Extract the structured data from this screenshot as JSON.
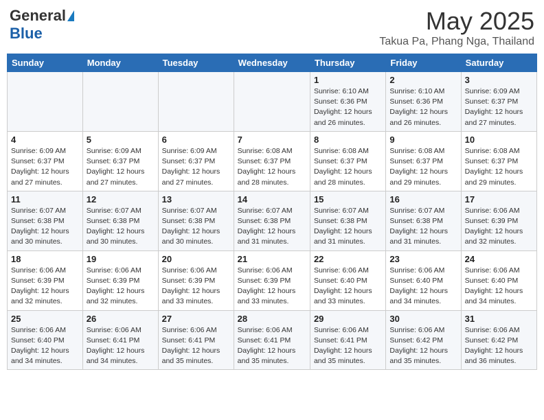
{
  "header": {
    "logo_general": "General",
    "logo_blue": "Blue",
    "month": "May 2025",
    "location": "Takua Pa, Phang Nga, Thailand"
  },
  "weekdays": [
    "Sunday",
    "Monday",
    "Tuesday",
    "Wednesday",
    "Thursday",
    "Friday",
    "Saturday"
  ],
  "weeks": [
    [
      {
        "day": "",
        "info": ""
      },
      {
        "day": "",
        "info": ""
      },
      {
        "day": "",
        "info": ""
      },
      {
        "day": "",
        "info": ""
      },
      {
        "day": "1",
        "info": "Sunrise: 6:10 AM\nSunset: 6:36 PM\nDaylight: 12 hours\nand 26 minutes."
      },
      {
        "day": "2",
        "info": "Sunrise: 6:10 AM\nSunset: 6:36 PM\nDaylight: 12 hours\nand 26 minutes."
      },
      {
        "day": "3",
        "info": "Sunrise: 6:09 AM\nSunset: 6:37 PM\nDaylight: 12 hours\nand 27 minutes."
      }
    ],
    [
      {
        "day": "4",
        "info": "Sunrise: 6:09 AM\nSunset: 6:37 PM\nDaylight: 12 hours\nand 27 minutes."
      },
      {
        "day": "5",
        "info": "Sunrise: 6:09 AM\nSunset: 6:37 PM\nDaylight: 12 hours\nand 27 minutes."
      },
      {
        "day": "6",
        "info": "Sunrise: 6:09 AM\nSunset: 6:37 PM\nDaylight: 12 hours\nand 27 minutes."
      },
      {
        "day": "7",
        "info": "Sunrise: 6:08 AM\nSunset: 6:37 PM\nDaylight: 12 hours\nand 28 minutes."
      },
      {
        "day": "8",
        "info": "Sunrise: 6:08 AM\nSunset: 6:37 PM\nDaylight: 12 hours\nand 28 minutes."
      },
      {
        "day": "9",
        "info": "Sunrise: 6:08 AM\nSunset: 6:37 PM\nDaylight: 12 hours\nand 29 minutes."
      },
      {
        "day": "10",
        "info": "Sunrise: 6:08 AM\nSunset: 6:37 PM\nDaylight: 12 hours\nand 29 minutes."
      }
    ],
    [
      {
        "day": "11",
        "info": "Sunrise: 6:07 AM\nSunset: 6:38 PM\nDaylight: 12 hours\nand 30 minutes."
      },
      {
        "day": "12",
        "info": "Sunrise: 6:07 AM\nSunset: 6:38 PM\nDaylight: 12 hours\nand 30 minutes."
      },
      {
        "day": "13",
        "info": "Sunrise: 6:07 AM\nSunset: 6:38 PM\nDaylight: 12 hours\nand 30 minutes."
      },
      {
        "day": "14",
        "info": "Sunrise: 6:07 AM\nSunset: 6:38 PM\nDaylight: 12 hours\nand 31 minutes."
      },
      {
        "day": "15",
        "info": "Sunrise: 6:07 AM\nSunset: 6:38 PM\nDaylight: 12 hours\nand 31 minutes."
      },
      {
        "day": "16",
        "info": "Sunrise: 6:07 AM\nSunset: 6:38 PM\nDaylight: 12 hours\nand 31 minutes."
      },
      {
        "day": "17",
        "info": "Sunrise: 6:06 AM\nSunset: 6:39 PM\nDaylight: 12 hours\nand 32 minutes."
      }
    ],
    [
      {
        "day": "18",
        "info": "Sunrise: 6:06 AM\nSunset: 6:39 PM\nDaylight: 12 hours\nand 32 minutes."
      },
      {
        "day": "19",
        "info": "Sunrise: 6:06 AM\nSunset: 6:39 PM\nDaylight: 12 hours\nand 32 minutes."
      },
      {
        "day": "20",
        "info": "Sunrise: 6:06 AM\nSunset: 6:39 PM\nDaylight: 12 hours\nand 33 minutes."
      },
      {
        "day": "21",
        "info": "Sunrise: 6:06 AM\nSunset: 6:39 PM\nDaylight: 12 hours\nand 33 minutes."
      },
      {
        "day": "22",
        "info": "Sunrise: 6:06 AM\nSunset: 6:40 PM\nDaylight: 12 hours\nand 33 minutes."
      },
      {
        "day": "23",
        "info": "Sunrise: 6:06 AM\nSunset: 6:40 PM\nDaylight: 12 hours\nand 34 minutes."
      },
      {
        "day": "24",
        "info": "Sunrise: 6:06 AM\nSunset: 6:40 PM\nDaylight: 12 hours\nand 34 minutes."
      }
    ],
    [
      {
        "day": "25",
        "info": "Sunrise: 6:06 AM\nSunset: 6:40 PM\nDaylight: 12 hours\nand 34 minutes."
      },
      {
        "day": "26",
        "info": "Sunrise: 6:06 AM\nSunset: 6:41 PM\nDaylight: 12 hours\nand 34 minutes."
      },
      {
        "day": "27",
        "info": "Sunrise: 6:06 AM\nSunset: 6:41 PM\nDaylight: 12 hours\nand 35 minutes."
      },
      {
        "day": "28",
        "info": "Sunrise: 6:06 AM\nSunset: 6:41 PM\nDaylight: 12 hours\nand 35 minutes."
      },
      {
        "day": "29",
        "info": "Sunrise: 6:06 AM\nSunset: 6:41 PM\nDaylight: 12 hours\nand 35 minutes."
      },
      {
        "day": "30",
        "info": "Sunrise: 6:06 AM\nSunset: 6:42 PM\nDaylight: 12 hours\nand 35 minutes."
      },
      {
        "day": "31",
        "info": "Sunrise: 6:06 AM\nSunset: 6:42 PM\nDaylight: 12 hours\nand 36 minutes."
      }
    ]
  ]
}
